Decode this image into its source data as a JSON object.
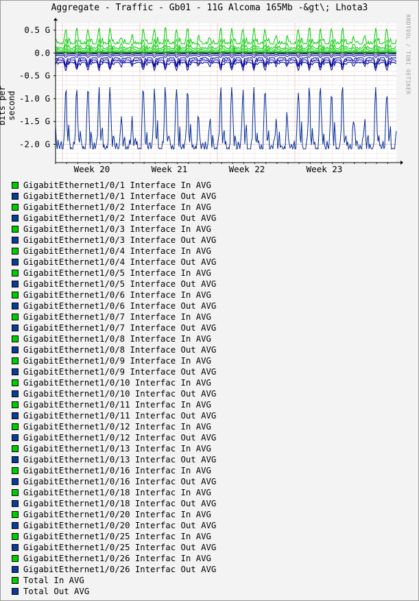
{
  "chart_data": {
    "type": "line",
    "title": "Aggregate - Traffic - Gb01 - 11G Alcoma 165Mb -&gt\\; Lhota3",
    "ylabel": "bits per second",
    "side_label": "RRDTOOL / TOBI OETIKER",
    "y_ticks": [
      "0.5 G",
      "0.0",
      "-0.5 G",
      "-1.0 G",
      "-1.5 G",
      "-2.0 G"
    ],
    "ylim": [
      -2.4,
      0.65
    ],
    "x_ticks": [
      "Week 20",
      "Week 21",
      "Week 22",
      "Week 23"
    ],
    "grid": true,
    "series_colors": {
      "in": "#00cc00",
      "out": "#0000a0",
      "total_in": "#00cc00",
      "total_out": "#002a97"
    },
    "daily_pattern": {
      "total_in_peak": 0.55,
      "total_in_base": 0.2,
      "total_out_peak": -0.75,
      "total_out_base": -2.1,
      "out_band_peak": -0.15,
      "out_band_base": -0.35
    }
  },
  "legend": [
    {
      "label": "GigabitEthernet1/0/1 Interface In AVG",
      "color": "#00cc00"
    },
    {
      "label": "GigabitEthernet1/0/1 Interface Out AVG",
      "color": "#0a3a9a"
    },
    {
      "label": "GigabitEthernet1/0/2 Interface In AVG",
      "color": "#00cc00"
    },
    {
      "label": "GigabitEthernet1/0/2 Interface Out AVG",
      "color": "#0a3a9a"
    },
    {
      "label": "GigabitEthernet1/0/3 Interface In AVG",
      "color": "#00cc00"
    },
    {
      "label": "GigabitEthernet1/0/3 Interface Out AVG",
      "color": "#0a3a9a"
    },
    {
      "label": "GigabitEthernet1/0/4 Interface In AVG",
      "color": "#00cc00"
    },
    {
      "label": "GigabitEthernet1/0/4 Interface Out AVG",
      "color": "#0a3a9a"
    },
    {
      "label": "GigabitEthernet1/0/5 Interface In AVG",
      "color": "#00cc00"
    },
    {
      "label": "GigabitEthernet1/0/5 Interface Out AVG",
      "color": "#0a3a9a"
    },
    {
      "label": "GigabitEthernet1/0/6 Interface In AVG",
      "color": "#00cc00"
    },
    {
      "label": "GigabitEthernet1/0/6 Interface Out AVG",
      "color": "#0a3a9a"
    },
    {
      "label": "GigabitEthernet1/0/7 Interface In AVG",
      "color": "#00cc00"
    },
    {
      "label": "GigabitEthernet1/0/7 Interface Out AVG",
      "color": "#0a3a9a"
    },
    {
      "label": "GigabitEthernet1/0/8 Interface In AVG",
      "color": "#00cc00"
    },
    {
      "label": "GigabitEthernet1/0/8 Interface Out AVG",
      "color": "#0a3a9a"
    },
    {
      "label": "GigabitEthernet1/0/9 Interface In AVG",
      "color": "#00cc00"
    },
    {
      "label": "GigabitEthernet1/0/9 Interface Out AVG",
      "color": "#0a3a9a"
    },
    {
      "label": "GigabitEthernet1/0/10 Interfac In AVG",
      "color": "#00cc00"
    },
    {
      "label": "GigabitEthernet1/0/10 Interfac Out AVG",
      "color": "#0a3a9a"
    },
    {
      "label": "GigabitEthernet1/0/11 Interfac In AVG",
      "color": "#00cc00"
    },
    {
      "label": "GigabitEthernet1/0/11 Interfac Out AVG",
      "color": "#0a3a9a"
    },
    {
      "label": "GigabitEthernet1/0/12 Interfac In AVG",
      "color": "#00cc00"
    },
    {
      "label": "GigabitEthernet1/0/12 Interfac Out AVG",
      "color": "#0a3a9a"
    },
    {
      "label": "GigabitEthernet1/0/13 Interfac In AVG",
      "color": "#00cc00"
    },
    {
      "label": "GigabitEthernet1/0/13 Interfac Out AVG",
      "color": "#0a3a9a"
    },
    {
      "label": "GigabitEthernet1/0/16 Interfac In AVG",
      "color": "#00cc00"
    },
    {
      "label": "GigabitEthernet1/0/16 Interfac Out AVG",
      "color": "#0a3a9a"
    },
    {
      "label": "GigabitEthernet1/0/18 Interfac In AVG",
      "color": "#00cc00"
    },
    {
      "label": "GigabitEthernet1/0/18 Interfac Out AVG",
      "color": "#0a3a9a"
    },
    {
      "label": "GigabitEthernet1/0/20 Interfac In AVG",
      "color": "#00cc00"
    },
    {
      "label": "GigabitEthernet1/0/20 Interfac Out AVG",
      "color": "#0a3a9a"
    },
    {
      "label": "GigabitEthernet1/0/25 Interfac In AVG",
      "color": "#00cc00"
    },
    {
      "label": "GigabitEthernet1/0/25 Interfac Out AVG",
      "color": "#0a3a9a"
    },
    {
      "label": "GigabitEthernet1/0/26 Interfac In AVG",
      "color": "#00cc00"
    },
    {
      "label": "GigabitEthernet1/0/26 Interfac Out AVG",
      "color": "#0a3a9a"
    },
    {
      "label": "Total In AVG",
      "color": "#00cc00"
    },
    {
      "label": "Total Out AVG",
      "color": "#0a3a9a"
    }
  ]
}
